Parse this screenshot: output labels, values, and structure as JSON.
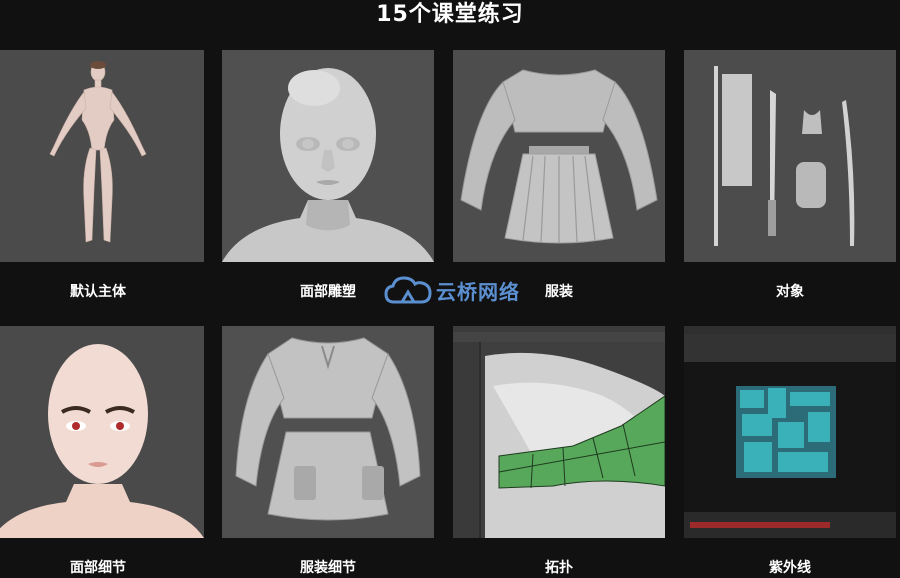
{
  "page": {
    "title": "15个课堂练习"
  },
  "watermark": {
    "text": "云桥网络",
    "color": "#5b8fd0"
  },
  "cards": [
    {
      "label": "默认主体",
      "icon": "female-base-body-render"
    },
    {
      "label": "面部雕塑",
      "icon": "head-sculpt-render"
    },
    {
      "label": "服装",
      "icon": "clothing-render"
    },
    {
      "label": "对象",
      "icon": "props-render"
    },
    {
      "label": "面部细节",
      "icon": "face-detail-render"
    },
    {
      "label": "服装细节",
      "icon": "clothing-detail-render"
    },
    {
      "label": "拓扑",
      "icon": "topology-screenshot"
    },
    {
      "label": "紫外线",
      "icon": "uv-layout-screenshot"
    }
  ]
}
